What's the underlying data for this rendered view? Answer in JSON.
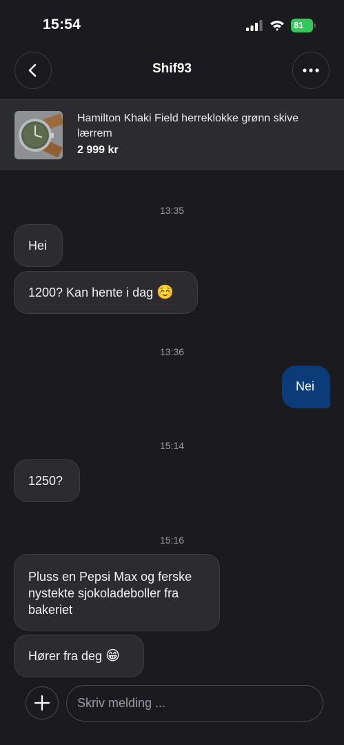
{
  "status_bar": {
    "time": "15:54",
    "battery": "81",
    "battery_color": "#34c759"
  },
  "header": {
    "title": "Shif93",
    "back_icon": "chevron-left-icon",
    "more_icon": "ellipsis-icon"
  },
  "listing": {
    "title": "Hamilton Khaki Field herreklokke grønn skive lærrem",
    "price": "2 999 kr"
  },
  "messages": {
    "ts1": "13:35",
    "m1": "Hei",
    "m2": "1200? Kan hente i dag",
    "m2_emoji": "☺️",
    "ts2": "13:36",
    "m3": "Nei",
    "ts3": "15:14",
    "m4": "1250?",
    "ts4": "15:16",
    "m5": "Pluss en Pepsi Max og ferske nystekte sjokoladeboller fra bakeriet",
    "m6": "Hører fra deg",
    "m6_emoji": "😁"
  },
  "composer": {
    "placeholder": "Skriv melding ..."
  },
  "colors": {
    "background": "#1b1b1f",
    "incoming_bubble": "#2c2c30",
    "outgoing_bubble": "#0b3b78"
  }
}
